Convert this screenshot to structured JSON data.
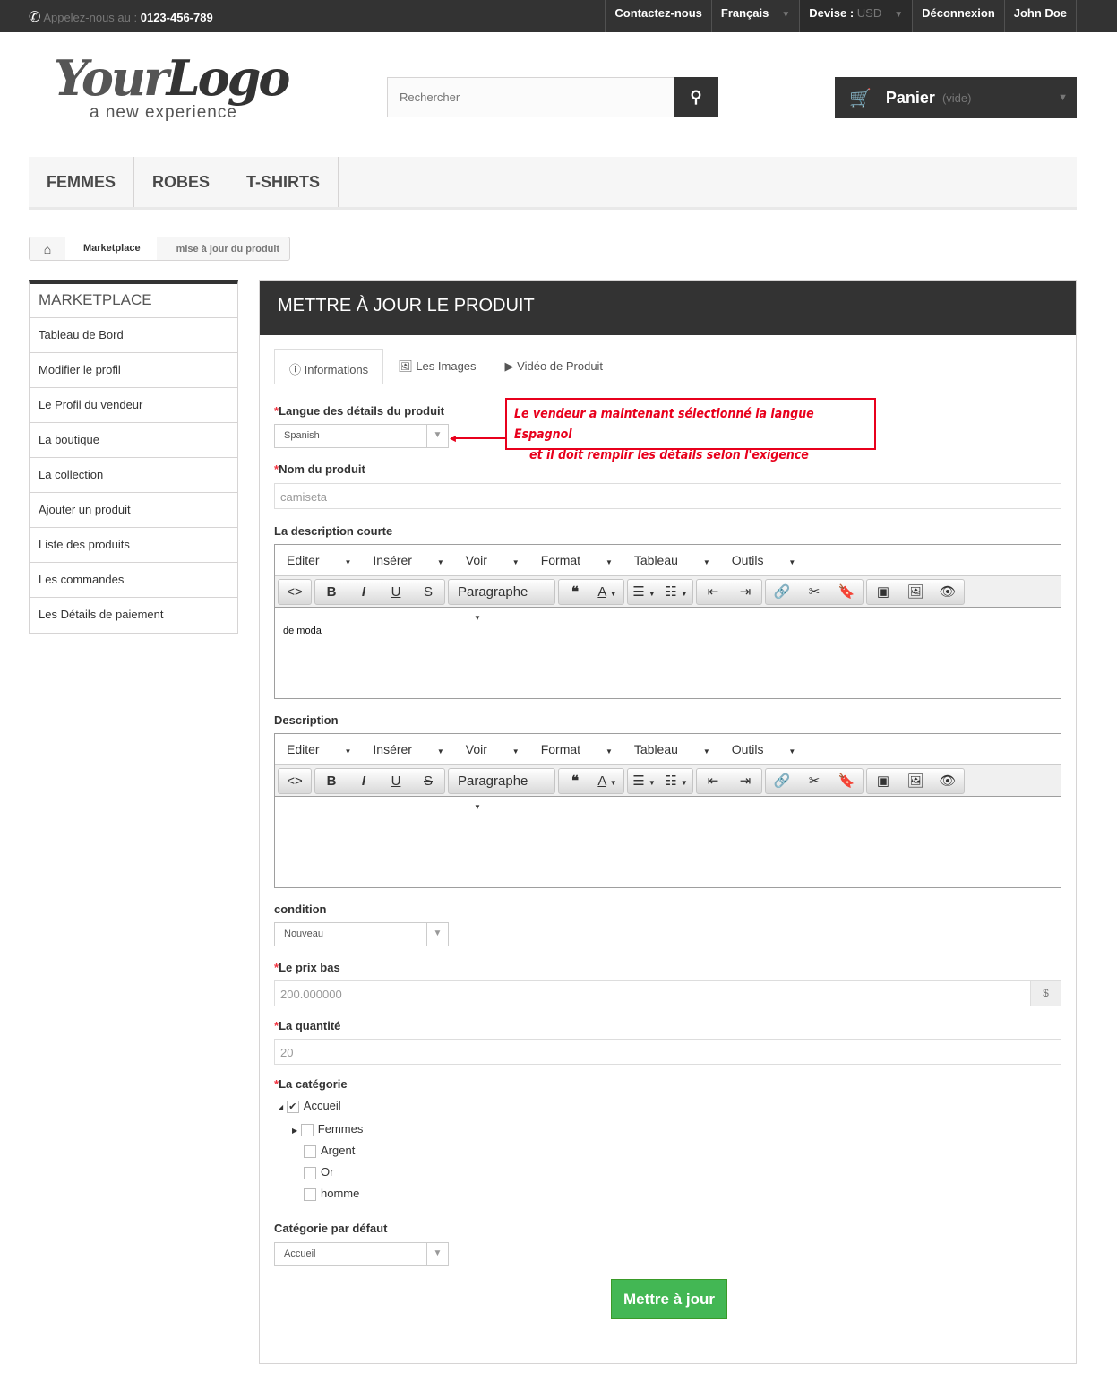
{
  "topbar": {
    "call_label": "Appelez-nous au :",
    "phone": "0123-456-789",
    "contact": "Contactez-nous",
    "language": "Français",
    "currency_label": "Devise :",
    "currency": "USD",
    "logout": "Déconnexion",
    "user": "John Doe"
  },
  "logo": {
    "text": "YourLogo",
    "tagline": "a new experience"
  },
  "search": {
    "placeholder": "Rechercher"
  },
  "cart": {
    "label": "Panier",
    "status": "(vide)"
  },
  "menu": [
    "FEMMES",
    "ROBES",
    "T-SHIRTS"
  ],
  "breadcrumb": {
    "items": [
      "Marketplace",
      "mise à jour du produit"
    ]
  },
  "sidebar": {
    "title": "MARKETPLACE",
    "items": [
      "Tableau de Bord",
      "Modifier le profil",
      "Le Profil du vendeur",
      "La boutique",
      "La collection",
      "Ajouter un produit",
      "Liste des produits",
      "Les commandes",
      "Les Détails de paiement"
    ]
  },
  "main": {
    "title": "METTRE À JOUR LE PRODUIT",
    "tabs": [
      "Informations",
      "Les Images",
      "Vidéo de Produit"
    ]
  },
  "form": {
    "lang_label": "Langue des détails du produit",
    "lang_value": "Spanish",
    "note_line1": "Le vendeur a maintenant sélectionné la langue Espagnol",
    "note_line2": "et il doit remplir les détails selon l'exigence",
    "name_label": "Nom du produit",
    "name_value": "camiseta",
    "short_desc_label": "La description courte",
    "short_desc_value": "de moda",
    "desc_label": "Description",
    "desc_value": "",
    "condition_label": "condition",
    "condition_value": "Nouveau",
    "price_label": "Le prix bas",
    "price_value": "200.000000",
    "price_currency": "$",
    "qty_label": "La quantité",
    "qty_value": "20",
    "category_label": "La catégorie",
    "categories": [
      {
        "name": "Accueil",
        "checked": true
      },
      {
        "name": "Femmes",
        "checked": false
      },
      {
        "name": "Argent",
        "checked": false
      },
      {
        "name": "Or",
        "checked": false
      },
      {
        "name": "homme",
        "checked": false
      }
    ],
    "default_cat_label": "Catégorie par défaut",
    "default_cat_value": "Accueil",
    "submit": "Mettre à jour"
  },
  "editor": {
    "menus": [
      "Editer",
      "Insérer",
      "Voir",
      "Format",
      "Tableau",
      "Outils"
    ],
    "format_select": "Paragraphe",
    "required_mark": "*"
  }
}
